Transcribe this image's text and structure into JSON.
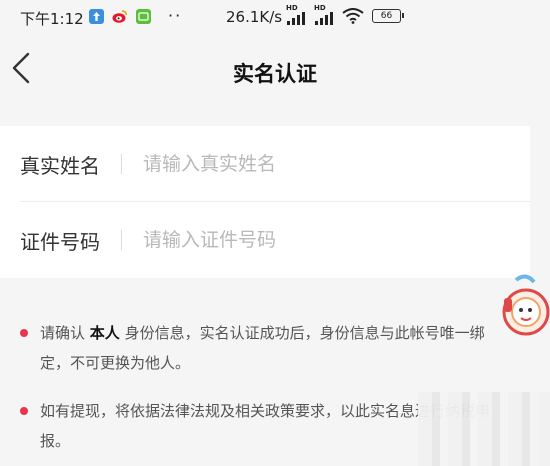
{
  "status_bar": {
    "time": "下午1:12",
    "dots": "··",
    "network_speed": "26.1K/s",
    "hd_label": "HD",
    "battery_level": "66",
    "icons": [
      "upload-icon",
      "weibo-icon",
      "app-icon",
      "signal-icon",
      "signal-icon",
      "wifi-icon",
      "battery-icon"
    ]
  },
  "header": {
    "title": "实名认证",
    "back_icon": "chevron-left-icon"
  },
  "form": {
    "name_label": "真实姓名",
    "name_placeholder": "请输入真实姓名",
    "id_label": "证件号码",
    "id_placeholder": "请输入证件号码"
  },
  "notes": {
    "note1_prefix": "请确认",
    "note1_emphasis": "本人",
    "note1_suffix": "身份信息，实名认证成功后，身份信息与此帐号唯一绑定，不可更换为他人。",
    "note2": "如有提现，将依据法律法规及相关政策要求，以此实名息进行纳税申报。"
  },
  "colors": {
    "accent": "#e8344d",
    "background": "#f5f5f5",
    "card": "#ffffff"
  }
}
